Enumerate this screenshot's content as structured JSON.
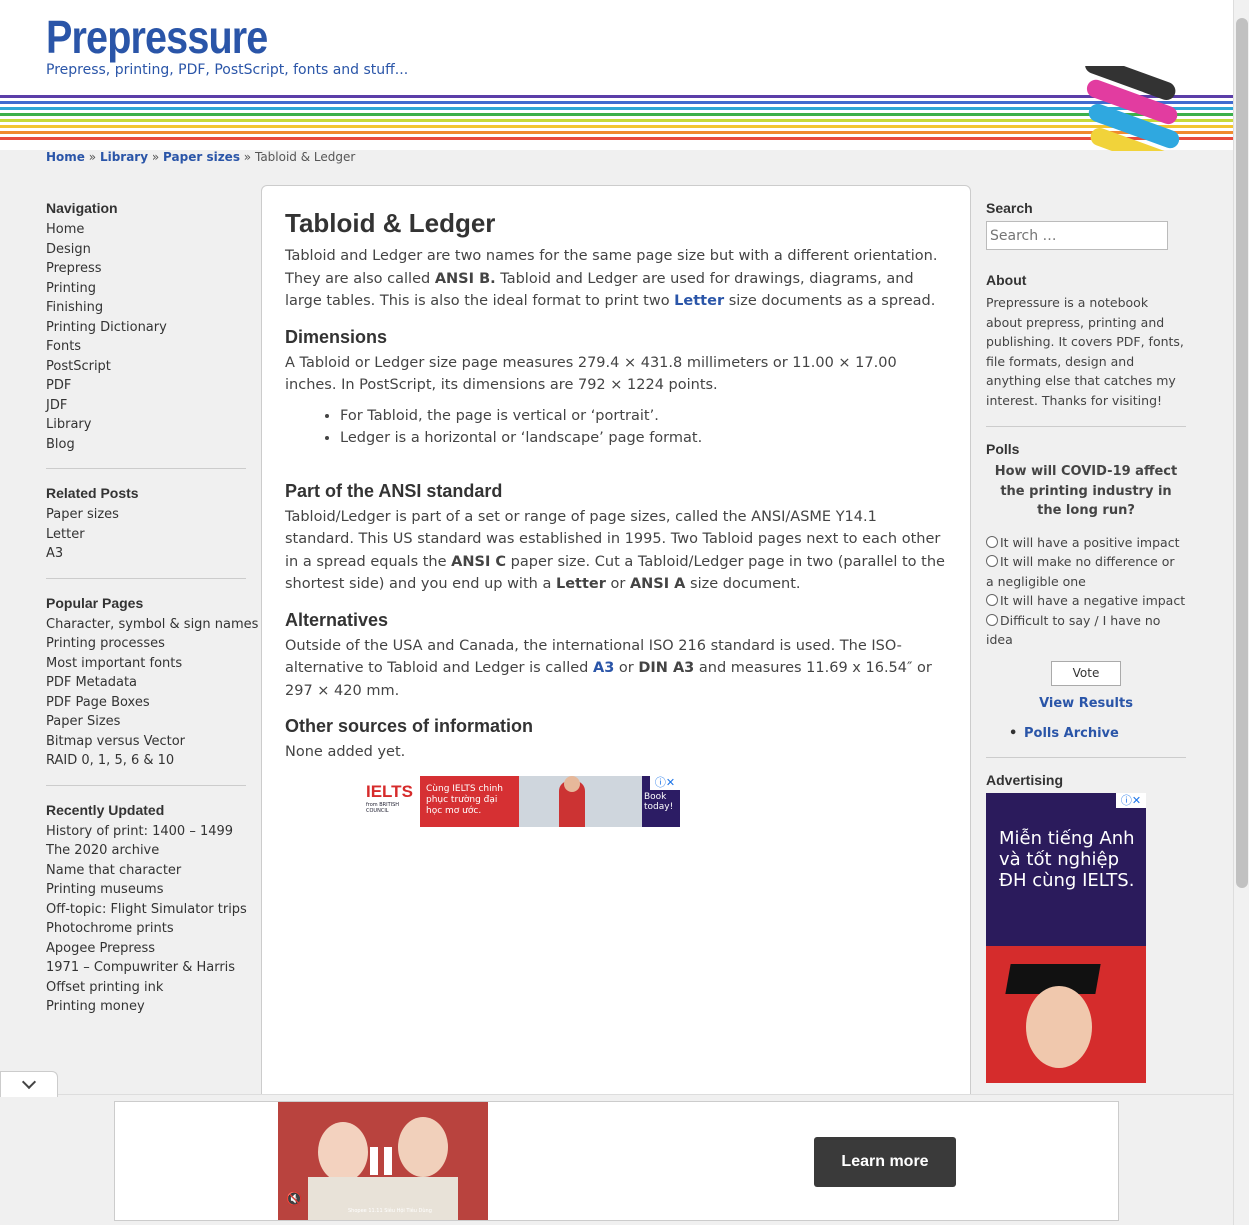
{
  "site": {
    "title": "Prepressure",
    "tagline": "Prepress, printing, PDF, PostScript, fonts and stuff..."
  },
  "breadcrumb": {
    "home": "Home",
    "library": "Library",
    "paper_sizes": "Paper sizes",
    "current": "Tabloid & Ledger",
    "sep": "»"
  },
  "left": {
    "navigation": {
      "heading": "Navigation",
      "items": [
        "Home",
        "Design",
        "Prepress",
        "Printing",
        "Finishing",
        "Printing Dictionary",
        "Fonts",
        "PostScript",
        "PDF",
        "JDF",
        "Library",
        "Blog"
      ]
    },
    "related": {
      "heading": "Related Posts",
      "items": [
        "Paper sizes",
        "Letter",
        "A3"
      ]
    },
    "popular": {
      "heading": "Popular Pages",
      "items": [
        "Character, symbol & sign names",
        "Printing processes",
        "Most important fonts",
        "PDF Metadata",
        "PDF Page Boxes",
        "Paper Sizes",
        "Bitmap versus Vector",
        "RAID 0, 1, 5, 6 & 10"
      ]
    },
    "recent": {
      "heading": "Recently Updated",
      "items": [
        "History of print: 1400 – 1499",
        "The 2020 archive",
        "Name that character",
        "Printing museums",
        "Off-topic: Flight Simulator trips",
        "Photochrome prints",
        "Apogee Prepress",
        "1971 – Compuwriter & Harris",
        "Offset printing ink",
        "Printing money"
      ]
    }
  },
  "article": {
    "title": "Tabloid & Ledger",
    "intro": {
      "t1": "Tabloid and Ledger are two names for the same page size but with a different orientation. They are also called ",
      "b1": "ANSI B.",
      "t2": " Tabloid and Ledger are used for drawings, diagrams, and large tables. This is also the ideal format to print two ",
      "link1": "Letter",
      "t3": " size documents as a spread."
    },
    "dimensions": {
      "heading": "Dimensions",
      "text": "A Tabloid or Ledger size page measures 279.4 × 431.8 millimeters or 11.00 × 17.00 inches. In PostScript, its dimensions are 792 × 1224 points.",
      "bullets": [
        "For Tabloid, the page is vertical or ‘portrait’.",
        "Ledger is a horizontal or ‘landscape’ page format."
      ]
    },
    "ansi": {
      "heading": "Part of the ANSI standard",
      "t1": "Tabloid/Ledger is part of a set or range of page sizes, called the ANSI/ASME Y14.1 standard. This US standard was established in 1995. Two Tabloid pages next to each other in a spread equals the ",
      "b1": "ANSI C",
      "t2": " paper size. Cut a Tabloid/Ledger page in two (parallel to the shortest side) and you end up with a ",
      "b2": "Letter",
      "t3": " or ",
      "b3": "ANSI A",
      "t4": " size document."
    },
    "alternatives": {
      "heading": "Alternatives",
      "t1": "Outside of the USA and Canada, the international ISO 216 standard is used. The ISO-alternative to Tabloid and Ledger is called ",
      "link1": "A3",
      "t2": " or ",
      "b1": "DIN A3",
      "t3": " and measures 11.69 x 16.54″ or 297 × 420 mm."
    },
    "other": {
      "heading": "Other sources of information",
      "text": "None added yet."
    },
    "ad": {
      "brand": "IELTS",
      "brand_sub": "from BRITISH COUNCIL",
      "text": "Cùng IELTS chinh phục trường đại học mơ ước.",
      "cta": "Book today!"
    }
  },
  "right": {
    "search": {
      "heading": "Search",
      "placeholder": "Search …"
    },
    "about": {
      "heading": "About",
      "text": "Prepressure is a notebook about prepress, printing and publishing. It covers PDF, fonts, file formats, design and anything else that catches my interest. Thanks for visiting!"
    },
    "polls": {
      "heading": "Polls",
      "question": "How will COVID-19 affect the printing industry in the long run?",
      "options": [
        "It will have a positive impact",
        "It will make no difference or a negligible one",
        "It will have a negative impact",
        "Difficult to say / I have no idea"
      ],
      "vote": "Vote",
      "view_results": "View Results",
      "archive": "Polls Archive"
    },
    "advertising": {
      "heading": "Advertising",
      "text": "Miễn tiếng Anh và tốt nghiệp ĐH cùng IELTS."
    }
  },
  "bottom_ad": {
    "cta": "Learn more",
    "video_caption": "Shopee 11.11 Siêu Hội Tiêu Dùng"
  }
}
